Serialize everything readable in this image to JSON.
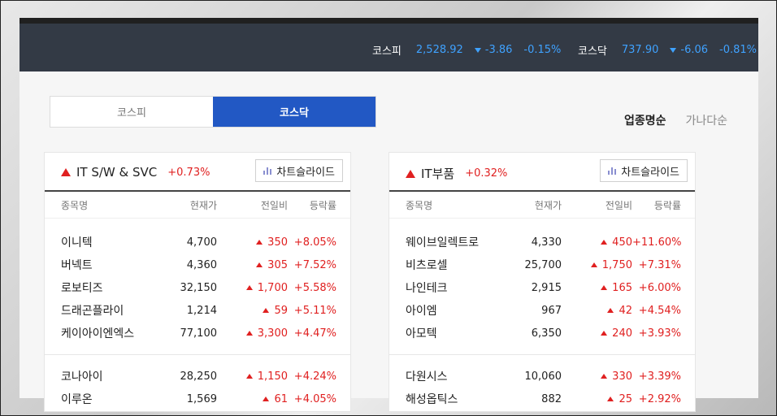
{
  "indices": [
    {
      "name": "코스피",
      "value": "2,528.92",
      "change": "-3.86",
      "rate": "-0.15%"
    },
    {
      "name": "코스닥",
      "value": "737.90",
      "change": "-6.06",
      "rate": "-0.81%"
    }
  ],
  "market_tabs": [
    "코스피",
    "코스닥"
  ],
  "active_market_tab": "코스닥",
  "sort_options": [
    "업종명순",
    "가나다순"
  ],
  "active_sort": "업종명순",
  "columns": [
    "종목명",
    "현재가",
    "전일비",
    "등락률"
  ],
  "chart_button_label": "차트슬라이드",
  "colors": {
    "up": "#e02020",
    "down": "#3fa2ff",
    "accent": "#2258c4",
    "topbar": "#333a45"
  },
  "icons": {
    "up": "triangle-up-icon",
    "down": "triangle-down-icon",
    "chart": "bar-chart-icon"
  },
  "sectors": [
    {
      "name": "IT S/W & SVC",
      "rate": "+0.73%",
      "group1": [
        {
          "name": "이니텍",
          "price": "4,700",
          "diff": "350",
          "rate": "+8.05%"
        },
        {
          "name": "버넥트",
          "price": "4,360",
          "diff": "305",
          "rate": "+7.52%"
        },
        {
          "name": "로보티즈",
          "price": "32,150",
          "diff": "1,700",
          "rate": "+5.58%"
        },
        {
          "name": "드래곤플라이",
          "price": "1,214",
          "diff": "59",
          "rate": "+5.11%"
        },
        {
          "name": "케이아이엔엑스",
          "price": "77,100",
          "diff": "3,300",
          "rate": "+4.47%"
        }
      ],
      "group2": [
        {
          "name": "코나아이",
          "price": "28,250",
          "diff": "1,150",
          "rate": "+4.24%"
        },
        {
          "name": "이루온",
          "price": "1,569",
          "diff": "61",
          "rate": "+4.05%"
        }
      ]
    },
    {
      "name": "IT부품",
      "rate": "+0.32%",
      "group1": [
        {
          "name": "웨이브일렉트로",
          "price": "4,330",
          "diff": "450",
          "rate": "+11.60%"
        },
        {
          "name": "비츠로셀",
          "price": "25,700",
          "diff": "1,750",
          "rate": "+7.31%"
        },
        {
          "name": "나인테크",
          "price": "2,915",
          "diff": "165",
          "rate": "+6.00%"
        },
        {
          "name": "아이엠",
          "price": "967",
          "diff": "42",
          "rate": "+4.54%"
        },
        {
          "name": "아모텍",
          "price": "6,350",
          "diff": "240",
          "rate": "+3.93%"
        }
      ],
      "group2": [
        {
          "name": "다원시스",
          "price": "10,060",
          "diff": "330",
          "rate": "+3.39%"
        },
        {
          "name": "해성옵틱스",
          "price": "882",
          "diff": "25",
          "rate": "+2.92%"
        }
      ]
    }
  ]
}
